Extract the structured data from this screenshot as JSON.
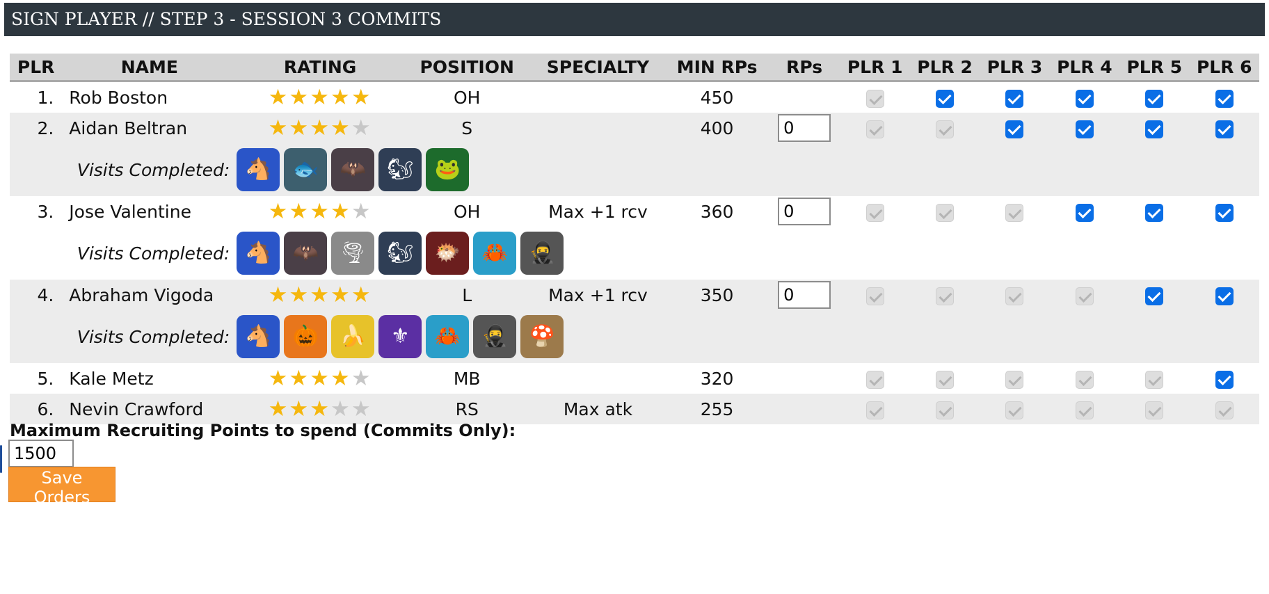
{
  "header": {
    "title": "SIGN PLAYER // STEP 3 - SESSION 3 COMMITS"
  },
  "columns": [
    "PLR",
    "NAME",
    "RATING",
    "POSITION",
    "SPECIALTY",
    "MIN RPs",
    "RPs",
    "PLR 1",
    "PLR 2",
    "PLR 3",
    "PLR 4",
    "PLR 5",
    "PLR 6"
  ],
  "visits_label": "Visits Completed:",
  "players": [
    {
      "num": "1.",
      "name": "Rob Boston",
      "stars": 5,
      "position": "OH",
      "specialty": "",
      "min_rps": "450",
      "rps": null,
      "plr": [
        "disabled",
        "checked",
        "checked",
        "checked",
        "checked",
        "checked"
      ],
      "visits": []
    },
    {
      "num": "2.",
      "name": "Aidan Beltran",
      "stars": 4,
      "position": "S",
      "specialty": "",
      "min_rps": "400",
      "rps": "0",
      "plr": [
        "disabled",
        "disabled",
        "checked",
        "checked",
        "checked",
        "checked"
      ],
      "visits": [
        "donkey-mascot",
        "marlin-mascot",
        "bat-mascot",
        "squirrel-mascot",
        "frog-mascot"
      ]
    },
    {
      "num": "3.",
      "name": "Jose Valentine",
      "stars": 4,
      "position": "OH",
      "specialty": "Max +1 rcv",
      "min_rps": "360",
      "rps": "0",
      "plr": [
        "disabled",
        "disabled",
        "disabled",
        "checked",
        "checked",
        "checked"
      ],
      "visits": [
        "donkey-mascot",
        "bat-mascot",
        "tornado-mascot",
        "squirrel-mascot",
        "anglerfish-mascot",
        "crab-mascot",
        "ninja-mascot"
      ]
    },
    {
      "num": "4.",
      "name": "Abraham Vigoda",
      "stars": 5,
      "position": "L",
      "specialty": "Max +1 rcv",
      "min_rps": "350",
      "rps": "0",
      "plr": [
        "disabled",
        "disabled",
        "disabled",
        "disabled",
        "checked",
        "checked"
      ],
      "visits": [
        "donkey-mascot",
        "pumpkin-mascot",
        "banana-mascot",
        "new-orleans-mascot",
        "crab-mascot",
        "ninja-mascot",
        "mushroom-mascot"
      ]
    },
    {
      "num": "5.",
      "name": "Kale Metz",
      "stars": 4,
      "position": "MB",
      "specialty": "",
      "min_rps": "320",
      "rps": null,
      "plr": [
        "disabled",
        "disabled",
        "disabled",
        "disabled",
        "disabled",
        "checked"
      ],
      "visits": []
    },
    {
      "num": "6.",
      "name": "Nevin Crawford",
      "stars": 3,
      "position": "RS",
      "specialty": "Max atk",
      "min_rps": "255",
      "rps": null,
      "plr": [
        "disabled",
        "disabled",
        "disabled",
        "disabled",
        "disabled",
        "disabled"
      ],
      "visits": []
    }
  ],
  "logo_styles": {
    "donkey-mascot": {
      "bg": "#2a55c8",
      "glyph": "🐴"
    },
    "marlin-mascot": {
      "bg": "#3d5f6e",
      "glyph": "🐟"
    },
    "bat-mascot": {
      "bg": "#4a3f47",
      "glyph": "🦇"
    },
    "squirrel-mascot": {
      "bg": "#2f3e55",
      "glyph": "🐿"
    },
    "frog-mascot": {
      "bg": "#1d6b2c",
      "glyph": "🐸"
    },
    "tornado-mascot": {
      "bg": "#8a8a8a",
      "glyph": "🌪"
    },
    "anglerfish-mascot": {
      "bg": "#6b1e1e",
      "glyph": "🐡"
    },
    "crab-mascot": {
      "bg": "#2a9ec9",
      "glyph": "🦀"
    },
    "ninja-mascot": {
      "bg": "#555555",
      "glyph": "🥷"
    },
    "pumpkin-mascot": {
      "bg": "#e8761c",
      "glyph": "🎃"
    },
    "banana-mascot": {
      "bg": "#e7c22a",
      "glyph": "🍌"
    },
    "new-orleans-mascot": {
      "bg": "#5b2fa3",
      "glyph": "⚜"
    },
    "mushroom-mascot": {
      "bg": "#9c7a4b",
      "glyph": "🍄"
    }
  },
  "star_colors": {
    "on": "#f5b70e",
    "off": "#c7c7c7"
  },
  "budget": {
    "label": "Maximum Recruiting Points to spend (Commits Only):",
    "value": "1500"
  },
  "save_button": {
    "label": "Save Orders",
    "color": "#f79631"
  }
}
